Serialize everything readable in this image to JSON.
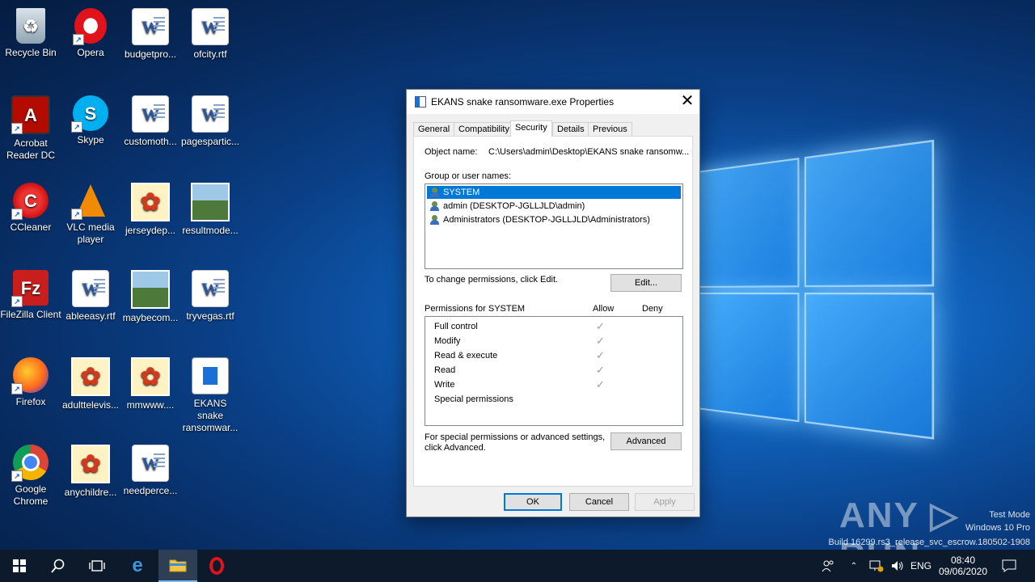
{
  "desktop": {
    "icons": [
      {
        "label": "Recycle Bin"
      },
      {
        "label": "Opera"
      },
      {
        "label": "budgetpro..."
      },
      {
        "label": "ofcity.rtf"
      },
      {
        "label": "Acrobat Reader DC"
      },
      {
        "label": "Skype"
      },
      {
        "label": "customoth..."
      },
      {
        "label": "pagespartic..."
      },
      {
        "label": "CCleaner"
      },
      {
        "label": "VLC media player"
      },
      {
        "label": "jerseydep..."
      },
      {
        "label": "resultmode..."
      },
      {
        "label": "FileZilla Client"
      },
      {
        "label": "ableeasy.rtf"
      },
      {
        "label": "maybecom..."
      },
      {
        "label": "tryvegas.rtf"
      },
      {
        "label": "Firefox"
      },
      {
        "label": "adulttelevis..."
      },
      {
        "label": "mmwww...."
      },
      {
        "label": "EKANS snake ransomwar..."
      },
      {
        "label": "Google Chrome"
      },
      {
        "label": "anychildre..."
      },
      {
        "label": "needperce..."
      }
    ]
  },
  "dialog": {
    "title": "EKANS snake ransomware.exe Properties",
    "close_glyph": "✕",
    "tabs": [
      "General",
      "Compatibility",
      "Security",
      "Details",
      "Previous Versions"
    ],
    "active_tab": "Security",
    "object_name_label": "Object name:",
    "object_name_value": "C:\\Users\\admin\\Desktop\\EKANS snake ransomw...",
    "group_label": "Group or user names:",
    "users": [
      "SYSTEM",
      "admin (DESKTOP-JGLLJLD\\admin)",
      "Administrators (DESKTOP-JGLLJLD\\Administrators)"
    ],
    "change_text": "To change permissions, click Edit.",
    "edit_label": "Edit...",
    "permissions_label": "Permissions for SYSTEM",
    "allow_label": "Allow",
    "deny_label": "Deny",
    "permissions": [
      {
        "name": "Full control",
        "allow": true
      },
      {
        "name": "Modify",
        "allow": true
      },
      {
        "name": "Read & execute",
        "allow": true
      },
      {
        "name": "Read",
        "allow": true
      },
      {
        "name": "Write",
        "allow": true
      },
      {
        "name": "Special permissions",
        "allow": false
      }
    ],
    "check_glyph": "✓",
    "advanced_text_1": "For special permissions or advanced settings,",
    "advanced_text_2": "click Advanced.",
    "advanced_label": "Advanced",
    "ok_label": "OK",
    "cancel_label": "Cancel",
    "apply_label": "Apply"
  },
  "watermark": {
    "brand": "ANY ▷ RUN",
    "line1": "Test Mode",
    "line2": "Windows 10 Pro",
    "line3": "Build 16299.rs3_release_svc_escrow.180502-1908"
  },
  "taskbar": {
    "language": "ENG",
    "time": "08:40",
    "date": "09/06/2020"
  },
  "colors": {
    "selection": "#0078d7",
    "taskbar": "#0d1a2b"
  }
}
